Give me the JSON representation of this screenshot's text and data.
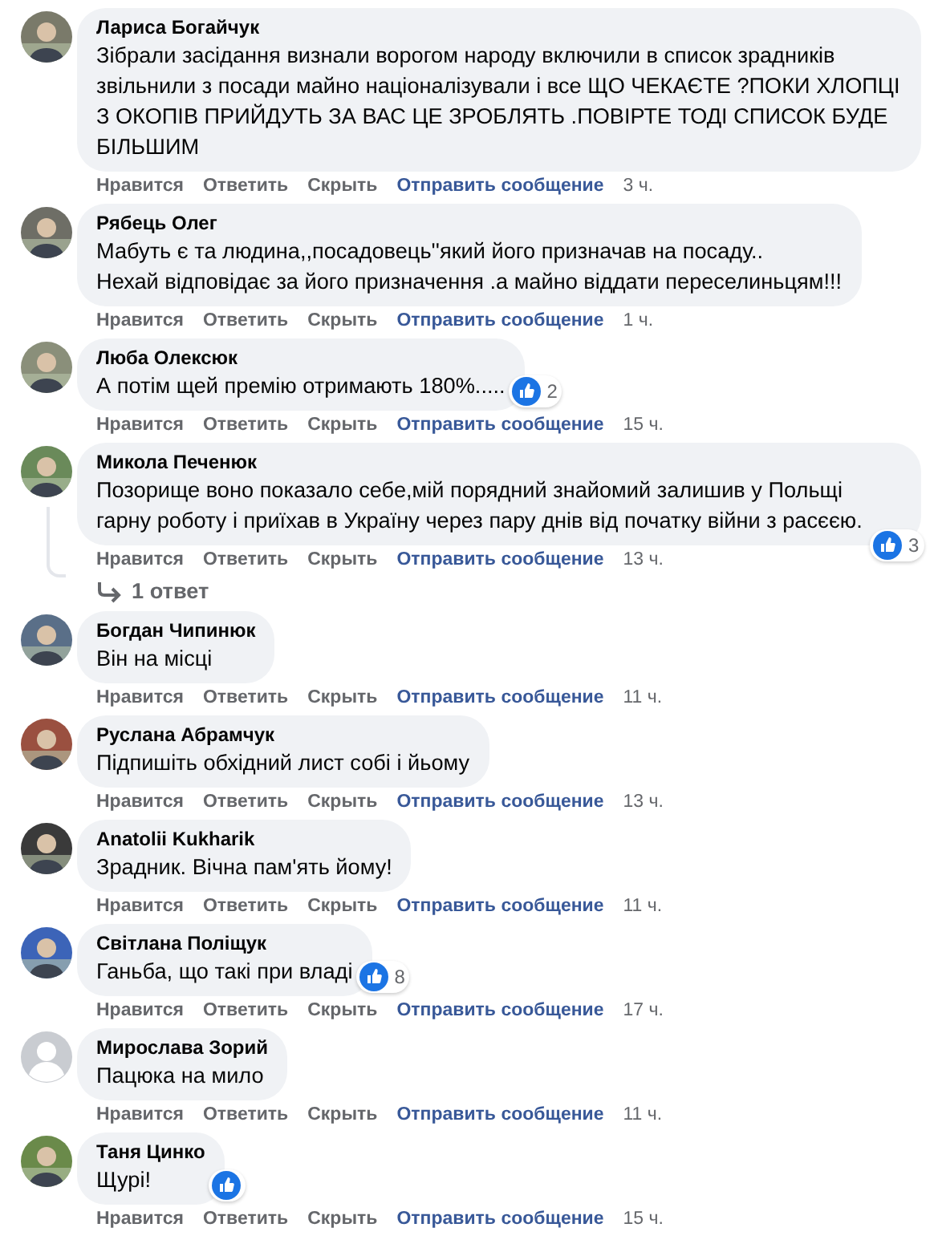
{
  "comments": [
    {
      "avatar": {
        "kind": "photo"
      },
      "author": "Лариса Богайчук",
      "text": "Зібрали засідання визнали ворогом народу включили в список зрадників звільнили з посади майно націоналізували і все ЩО ЧЕКАЄТЕ ?ПОКИ ХЛОПЦІ З ОКОПІВ ПРИЙДУТЬ ЗА ВАС ЦЕ ЗРОБЛЯТЬ .ПОВІРТЕ ТОДІ СПИСОК БУДЕ БІЛЬШИМ",
      "actions": [
        "Нравится",
        "Ответить",
        "Скрыть",
        "Отправить сообщение"
      ],
      "time": "3 ч."
    },
    {
      "avatar": {
        "kind": "photo"
      },
      "author": "Рябець Олег",
      "text": "Мабуть є та людина,,посадовець''який його призначав на посаду..\nНехай відповідає за його призначення .а майно віддати переселиньцям!!!",
      "actions": [
        "Нравится",
        "Ответить",
        "Скрыть",
        "Отправить сообщение"
      ],
      "time": "1 ч."
    },
    {
      "avatar": {
        "kind": "photo"
      },
      "author": "Люба Олексюк",
      "text": "А потім щей премію отримають 180%.....",
      "reactions": {
        "kind": "like",
        "count": "2"
      },
      "actions": [
        "Нравится",
        "Ответить",
        "Скрыть",
        "Отправить сообщение"
      ],
      "time": "15 ч."
    },
    {
      "avatar": {
        "kind": "photo"
      },
      "author": "Микола Печенюк",
      "text": "Позорище воно показало себе,мій порядний знайомий залишив у Польщі гарну роботу і приїхав в Україну через пару днів від початку війни з расєєю.",
      "reactions": {
        "kind": "like",
        "count": "3"
      },
      "actions": [
        "Нравится",
        "Ответить",
        "Скрыть",
        "Отправить сообщение"
      ],
      "time": "13 ч.",
      "replies": "1 ответ"
    },
    {
      "avatar": {
        "kind": "photo"
      },
      "author": "Богдан Чипинюк",
      "text": "Він на місці",
      "actions": [
        "Нравится",
        "Ответить",
        "Скрыть",
        "Отправить сообщение"
      ],
      "time": "11 ч."
    },
    {
      "avatar": {
        "kind": "photo"
      },
      "author": "Руслана Абрамчук",
      "text": "Підпишіть обхідний лист собі і йьому",
      "actions": [
        "Нравится",
        "Ответить",
        "Скрыть",
        "Отправить сообщение"
      ],
      "time": "13 ч."
    },
    {
      "avatar": {
        "kind": "photo"
      },
      "author": "Anatolii Kukharik",
      "text": "Зрадник. Вічна пам'ять йому!",
      "actions": [
        "Нравится",
        "Ответить",
        "Скрыть",
        "Отправить сообщение"
      ],
      "time": "11 ч."
    },
    {
      "avatar": {
        "kind": "photo"
      },
      "author": "Світлана Поліщук",
      "text": "Ганьба, що такі при владі",
      "reactions": {
        "kind": "like",
        "count": "8"
      },
      "actions": [
        "Нравится",
        "Ответить",
        "Скрыть",
        "Отправить сообщение"
      ],
      "time": "17 ч."
    },
    {
      "avatar": {
        "kind": "default"
      },
      "author": "Мирослава Зорий",
      "text": "Пацюка на мило",
      "actions": [
        "Нравится",
        "Ответить",
        "Скрыть",
        "Отправить сообщение"
      ],
      "time": "11 ч."
    },
    {
      "avatar": {
        "kind": "photo"
      },
      "author": "Таня Цинко",
      "text": "Щурі!",
      "reactions": {
        "kind": "like"
      },
      "actions": [
        "Нравится",
        "Ответить",
        "Скрыть",
        "Отправить сообщение"
      ],
      "time": "15 ч."
    }
  ]
}
